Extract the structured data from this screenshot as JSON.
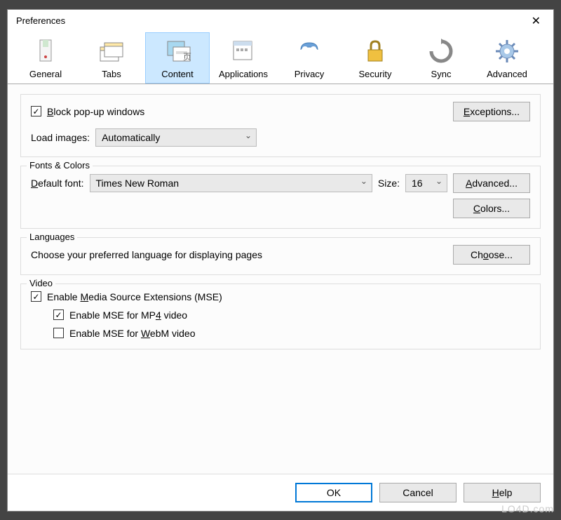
{
  "window": {
    "title": "Preferences",
    "close": "✕"
  },
  "toolbar": {
    "items": [
      {
        "label": "General"
      },
      {
        "label": "Tabs"
      },
      {
        "label": "Content"
      },
      {
        "label": "Applications"
      },
      {
        "label": "Privacy"
      },
      {
        "label": "Security"
      },
      {
        "label": "Sync"
      },
      {
        "label": "Advanced"
      }
    ]
  },
  "popup": {
    "block_prefix": "B",
    "block_rest": "lock pop-up windows",
    "exceptions_u": "E",
    "exceptions_rest": "xceptions...",
    "load_images_label": "Load images:",
    "load_images_value": "Automatically"
  },
  "fonts": {
    "legend": "Fonts & Colors",
    "default_font_u": "D",
    "default_font_rest": "efault font:",
    "default_font_value": "Times New Roman",
    "size_label": "Size:",
    "size_value": "16",
    "advanced_u": "A",
    "advanced_rest": "dvanced...",
    "colors_u": "C",
    "colors_rest": "olors..."
  },
  "languages": {
    "legend": "Languages",
    "desc": "Choose your preferred language for displaying pages",
    "choose_label": "Ch",
    "choose_u": "o",
    "choose_rest": "ose..."
  },
  "video": {
    "legend": "Video",
    "mse_prefix": "Enable ",
    "mse_u": "M",
    "mse_rest": "edia Source Extensions (MSE)",
    "mp4_prefix": "Enable MSE for MP",
    "mp4_u": "4",
    "mp4_rest": " video",
    "webm_prefix": "Enable MSE for ",
    "webm_u": "W",
    "webm_rest": "ebM video"
  },
  "footer": {
    "ok": "OK",
    "cancel": "Cancel",
    "help_u": "H",
    "help_rest": "elp"
  },
  "watermark": "LO4D.com"
}
